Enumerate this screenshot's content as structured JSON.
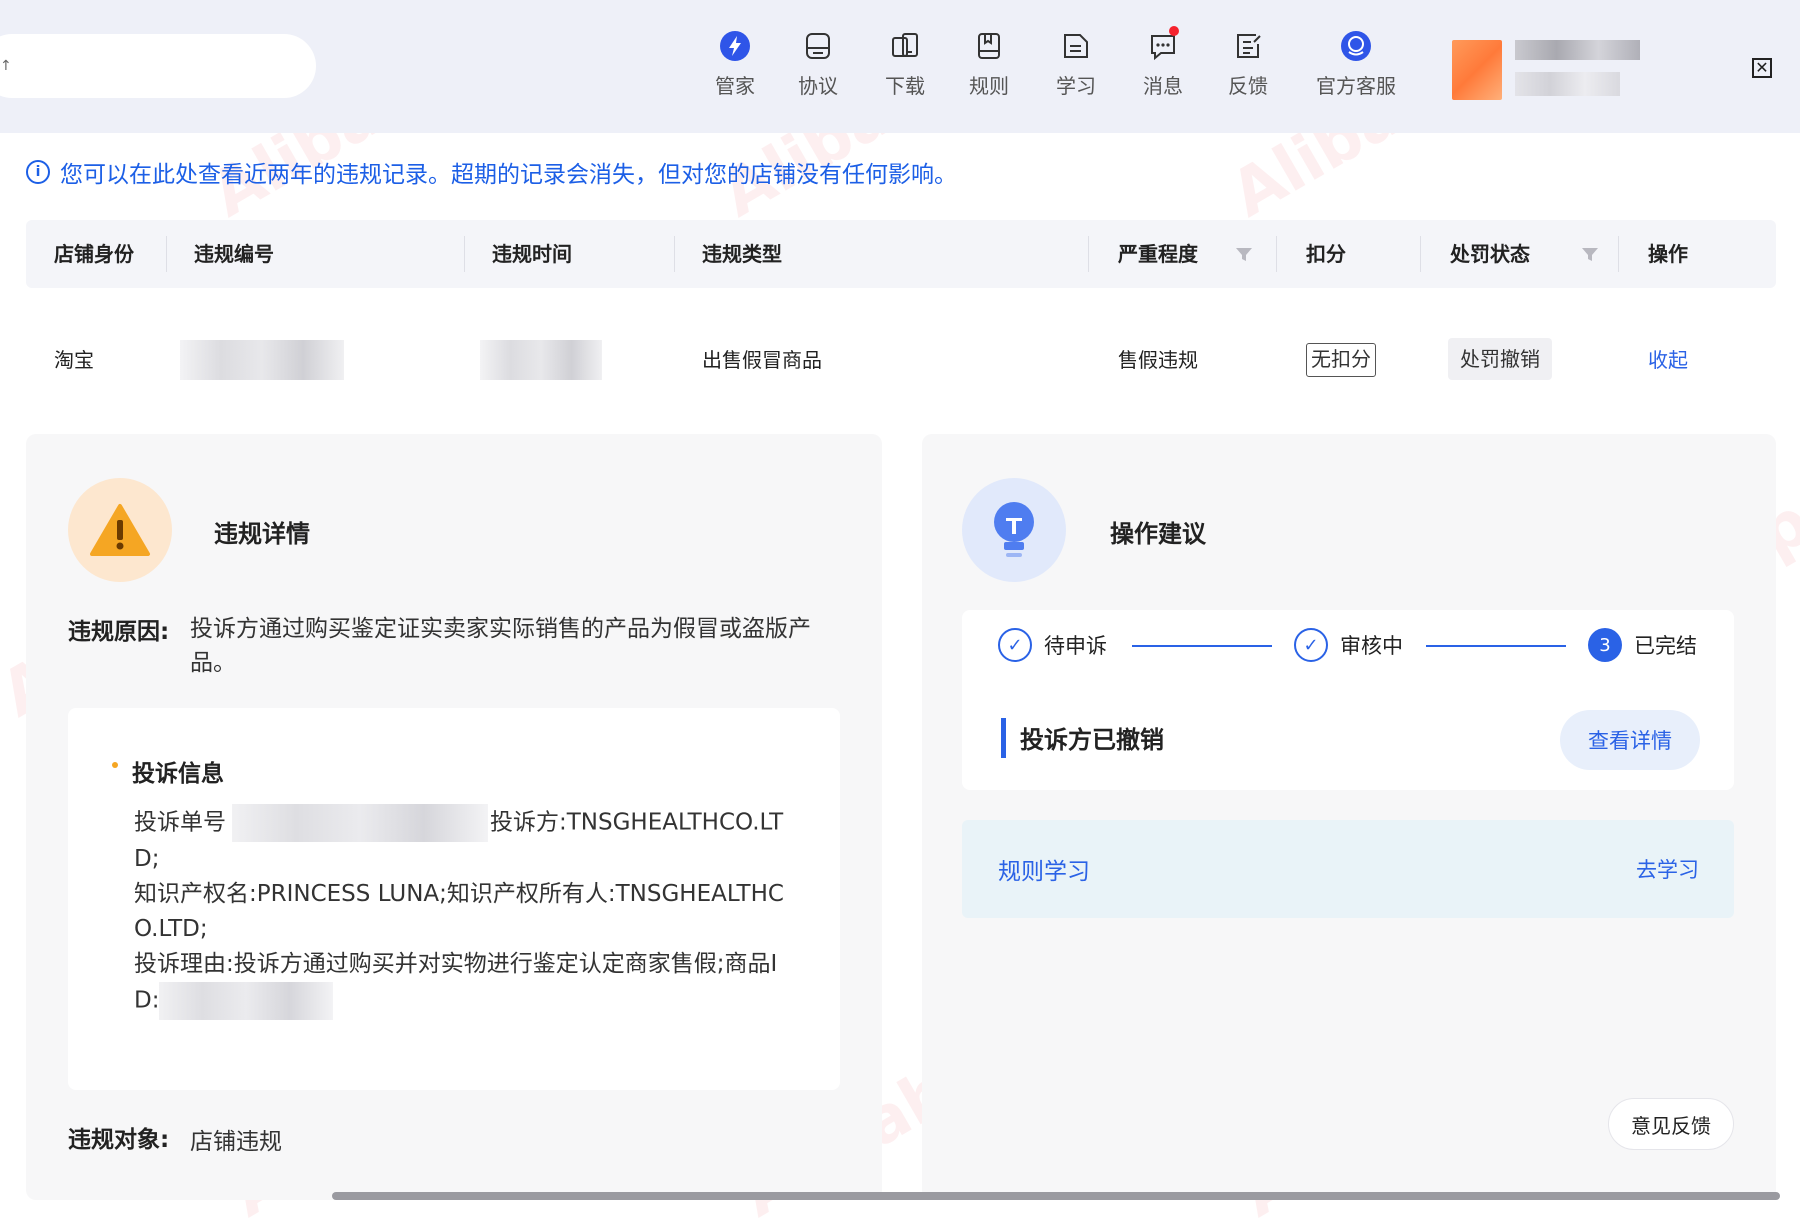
{
  "topbar": {
    "nav": [
      {
        "label": "管家",
        "icon": "lightning-icon"
      },
      {
        "label": "协议",
        "icon": "agreement-icon"
      },
      {
        "label": "下载",
        "icon": "download-icon"
      },
      {
        "label": "规则",
        "icon": "rules-icon"
      },
      {
        "label": "学习",
        "icon": "learn-icon"
      },
      {
        "label": "消息",
        "icon": "message-icon"
      },
      {
        "label": "反馈",
        "icon": "feedback-icon"
      },
      {
        "label": "官方客服",
        "icon": "customer-service-icon"
      }
    ],
    "close_label": "✕"
  },
  "notice": {
    "icon": "info-icon",
    "text": "您可以在此处查看近两年的违规记录。超期的记录会消失，但对您的店铺没有任何影响。"
  },
  "table": {
    "headers": [
      "店铺身份",
      "违规编号",
      "违规时间",
      "违规类型",
      "严重程度",
      "扣分",
      "处罚状态",
      "操作"
    ],
    "row": {
      "identity": "淘宝",
      "type": "出售假冒商品",
      "severity": "售假违规",
      "deduction": "无扣分",
      "status": "处罚撤销",
      "action": "收起"
    }
  },
  "details": {
    "title": "违规详情",
    "reason_label": "违规原因:",
    "reason_text": "投诉方通过购买鉴定证实卖家实际销售的产品为假冒或盗版产品。",
    "complaint": {
      "title": "投诉信息",
      "order_label": "投诉单号",
      "complainant": "投诉方:TNSGHEALTHCO.LTD;",
      "ip_line": "知识产权名:PRINCESS LUNA;知识产权所有人:TNSGHEALTHCO.LTD;",
      "reason_line": "投诉理由:投诉方通过购买并对实物进行鉴定认定商家售假;商品ID:"
    },
    "target_label": "违规对象:",
    "target_value": "店铺违规"
  },
  "advice": {
    "title": "操作建议",
    "steps": [
      {
        "label": "待申诉",
        "state": "done",
        "mark": "✓"
      },
      {
        "label": "审核中",
        "state": "done",
        "mark": "✓"
      },
      {
        "label": "已完结",
        "state": "current",
        "mark": "3"
      }
    ],
    "status_text": "投诉方已撤销",
    "detail_button": "查看详情",
    "rule_label": "规则学习",
    "rule_link": "去学习"
  },
  "feedback_button": "意见反馈",
  "watermark": "Alibaba-ipp",
  "colors": {
    "accent": "#2a62e6",
    "warn": "#f5a623",
    "red_dot": "#f5222d"
  }
}
